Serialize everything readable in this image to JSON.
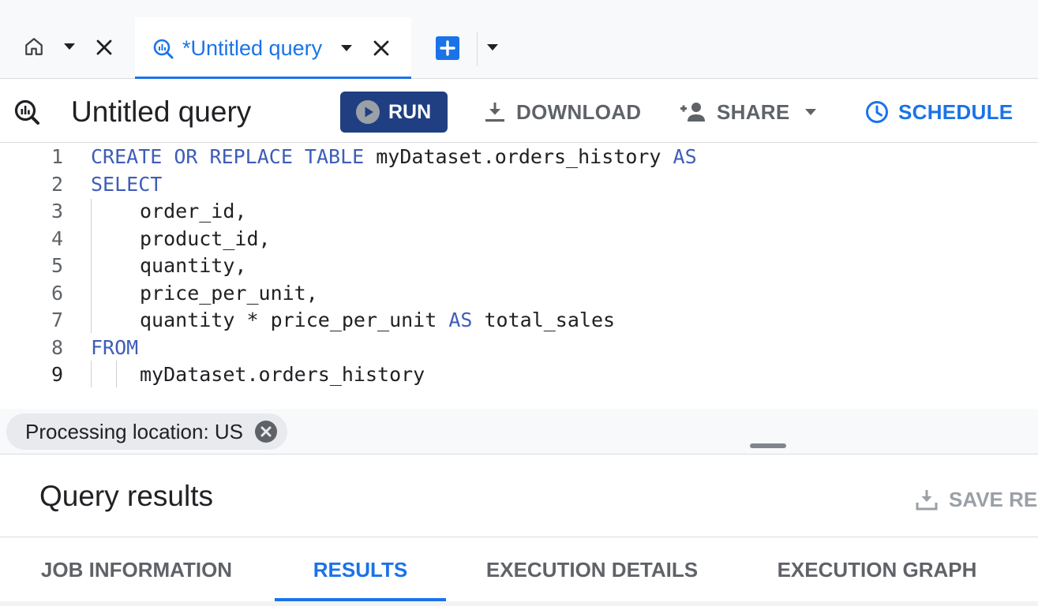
{
  "tabs": {
    "home": {
      "icon": "home-icon"
    },
    "query_tab": {
      "title": "*Untitled query",
      "icon": "query-icon"
    },
    "new_tab": {
      "icon": "plus-icon"
    }
  },
  "toolbar": {
    "title": "Untitled query",
    "run_label": "RUN",
    "download_label": "DOWNLOAD",
    "share_label": "SHARE",
    "schedule_label": "SCHEDULE"
  },
  "editor": {
    "lines": [
      {
        "n": "1",
        "segments": [
          {
            "t": "CREATE OR REPLACE TABLE",
            "kw": true
          },
          {
            "t": " myDataset.orders_history ",
            "kw": false
          },
          {
            "t": "AS",
            "kw": true
          }
        ]
      },
      {
        "n": "2",
        "segments": [
          {
            "t": "SELECT",
            "kw": true
          }
        ]
      },
      {
        "n": "3",
        "segments": [
          {
            "t": "order_id,",
            "kw": false
          }
        ]
      },
      {
        "n": "4",
        "segments": [
          {
            "t": "product_id,",
            "kw": false
          }
        ]
      },
      {
        "n": "5",
        "segments": [
          {
            "t": "quantity,",
            "kw": false
          }
        ]
      },
      {
        "n": "6",
        "segments": [
          {
            "t": "price_per_unit,",
            "kw": false
          }
        ]
      },
      {
        "n": "7",
        "segments": [
          {
            "t": "quantity * price_per_unit ",
            "kw": false
          },
          {
            "t": "AS",
            "kw": true
          },
          {
            "t": " total_sales",
            "kw": false
          }
        ]
      },
      {
        "n": "8",
        "segments": [
          {
            "t": "FROM",
            "kw": true
          }
        ]
      },
      {
        "n": "9",
        "segments": [
          {
            "t": "myDataset.orders_history",
            "kw": false
          }
        ]
      }
    ]
  },
  "status": {
    "location": "Processing location: US"
  },
  "results": {
    "title": "Query results",
    "save_label": "SAVE RES",
    "tabs": [
      {
        "label": "JOB INFORMATION",
        "active": false
      },
      {
        "label": "RESULTS",
        "active": true
      },
      {
        "label": "EXECUTION DETAILS",
        "active": false
      },
      {
        "label": "EXECUTION GRAPH",
        "active": false
      }
    ]
  },
  "colors": {
    "accent": "#1a73e8",
    "run_button": "#1f3f82",
    "keyword": "#3d5db8"
  }
}
